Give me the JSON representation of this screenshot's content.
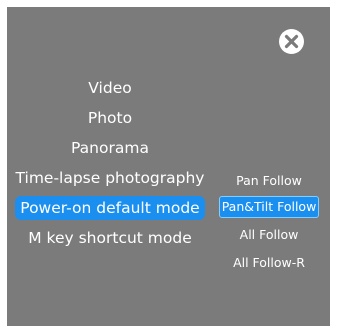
{
  "menu": {
    "items": [
      {
        "label": "Video"
      },
      {
        "label": "Photo"
      },
      {
        "label": "Panorama"
      },
      {
        "label": "Time-lapse photography"
      },
      {
        "label": "Power-on default mode"
      },
      {
        "label": "M key shortcut mode"
      }
    ],
    "selected": "Power-on default mode"
  },
  "submenu": {
    "items": [
      {
        "label": "Pan Follow"
      },
      {
        "label": "Pan&Tilt Follow"
      },
      {
        "label": "All Follow"
      },
      {
        "label": "All Follow-R"
      }
    ],
    "selected": "Pan&Tilt Follow"
  },
  "icons": {
    "close": "close-icon"
  },
  "colors": {
    "panel_bg": "#7b7b7b",
    "accent": "#1a8ff0",
    "text": "#ffffff"
  }
}
